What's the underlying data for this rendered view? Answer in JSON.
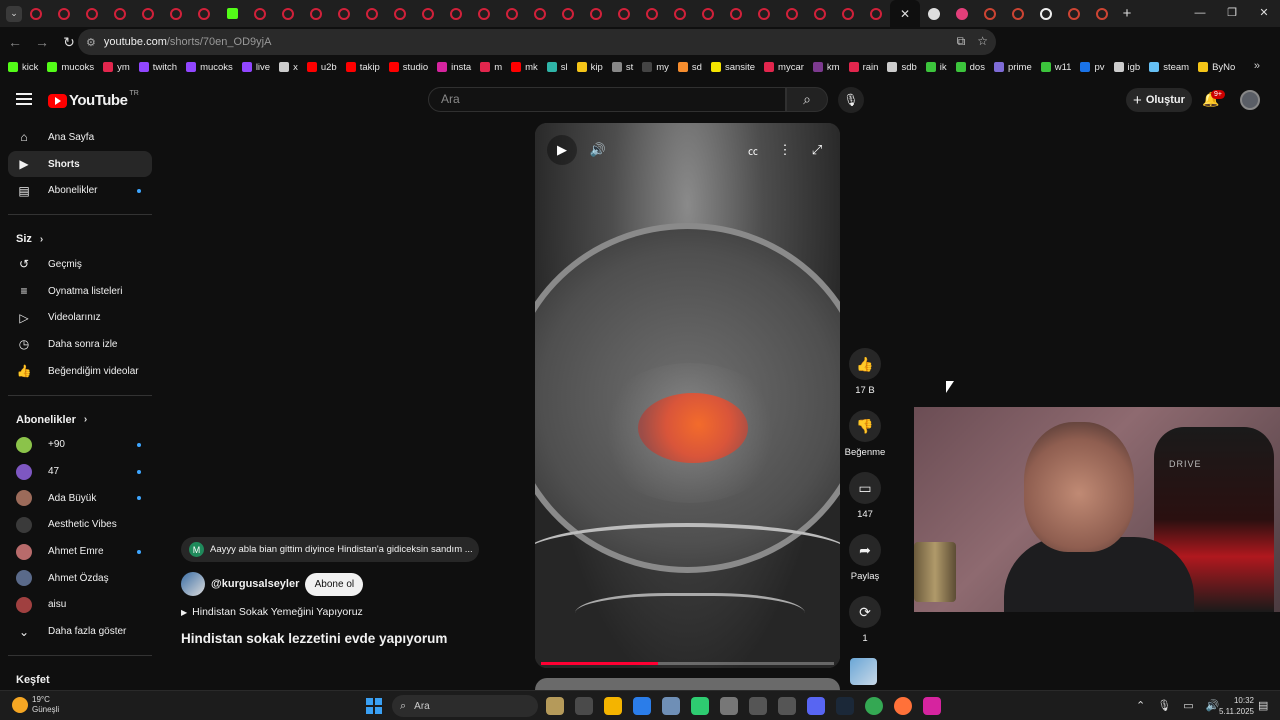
{
  "browser": {
    "active_tab_close": "✕",
    "url_host": "youtube.com",
    "url_path": "/shorts/70en_OD9yjA",
    "new_tab": "+",
    "win_minimize": "—",
    "win_restore": "❐",
    "win_close": "✕"
  },
  "bookmarks": [
    {
      "label": "kick",
      "color": "#53fc18"
    },
    {
      "label": "mucoks",
      "color": "#53fc18"
    },
    {
      "label": "ym",
      "color": "#e2264d"
    },
    {
      "label": "twitch",
      "color": "#9146ff"
    },
    {
      "label": "mucoks",
      "color": "#9146ff"
    },
    {
      "label": "live",
      "color": "#9146ff"
    },
    {
      "label": "x",
      "color": "#cccccc"
    },
    {
      "label": "u2b",
      "color": "#ff0000"
    },
    {
      "label": "takip",
      "color": "#ff0000"
    },
    {
      "label": "studio",
      "color": "#ff0000"
    },
    {
      "label": "insta",
      "color": "#d6249f"
    },
    {
      "label": "m",
      "color": "#e2264d"
    },
    {
      "label": "mk",
      "color": "#ff0000"
    },
    {
      "label": "sl",
      "color": "#2fb5a8"
    },
    {
      "label": "kip",
      "color": "#f5c518"
    },
    {
      "label": "st",
      "color": "#888888"
    },
    {
      "label": "my",
      "color": "#444444"
    },
    {
      "label": "sd",
      "color": "#f68d2e"
    },
    {
      "label": "sansite",
      "color": "#f5e400"
    },
    {
      "label": "mycar",
      "color": "#e2264d"
    },
    {
      "label": "km",
      "color": "#7c3a8f"
    },
    {
      "label": "rain",
      "color": "#e2264d"
    },
    {
      "label": "sdb",
      "color": "#cccccc"
    },
    {
      "label": "ik",
      "color": "#3cc43c"
    },
    {
      "label": "dos",
      "color": "#3cc43c"
    },
    {
      "label": "prime",
      "color": "#7e6bd6"
    },
    {
      "label": "w11",
      "color": "#3cc43c"
    },
    {
      "label": "pv",
      "color": "#1a73e8"
    },
    {
      "label": "igb",
      "color": "#cccccc"
    },
    {
      "label": "steam",
      "color": "#66c0f4"
    },
    {
      "label": "ByNo",
      "color": "#f5c518"
    }
  ],
  "bookmarks_more": "»",
  "yt": {
    "logo_text": "YouTube",
    "logo_region": "TR",
    "search_placeholder": "Ara",
    "create_label": "Oluştur",
    "notifications_badge": "9+"
  },
  "sidebar": {
    "main": [
      {
        "label": "Ana Sayfa",
        "icon": "home-icon",
        "glyph": "⌂"
      },
      {
        "label": "Shorts",
        "icon": "shorts-icon",
        "glyph": "▶",
        "active": true
      },
      {
        "label": "Abonelikler",
        "icon": "subscriptions-icon",
        "glyph": "▤",
        "dot": true
      }
    ],
    "you_header": "Siz",
    "you": [
      {
        "label": "Geçmiş",
        "icon": "history-icon",
        "glyph": "↺"
      },
      {
        "label": "Oynatma listeleri",
        "icon": "playlists-icon",
        "glyph": "≡"
      },
      {
        "label": "Videolarınız",
        "icon": "your-videos-icon",
        "glyph": "▷"
      },
      {
        "label": "Daha sonra izle",
        "icon": "watch-later-icon",
        "glyph": "◷"
      },
      {
        "label": "Beğendiğim videolar",
        "icon": "liked-videos-icon",
        "glyph": "👍"
      }
    ],
    "subs_header": "Abonelikler",
    "subs": [
      {
        "label": "+90",
        "color": "#8bc34a",
        "dot": true
      },
      {
        "label": "47",
        "color": "#7e57c2",
        "dot": true
      },
      {
        "label": "Ada Büyük",
        "color": "#9c6b5a",
        "dot": true
      },
      {
        "label": "Aesthetic Vibes",
        "color": "#3a3a3a",
        "dot": false
      },
      {
        "label": "Ahmet Emre",
        "color": "#b86b6b",
        "dot": true
      },
      {
        "label": "Ahmet Özdaş",
        "color": "#5a6a8a",
        "dot": false
      },
      {
        "label": "aisu",
        "color": "#a04040",
        "dot": false
      }
    ],
    "show_more": "Daha fazla göster",
    "explore_header": "Keşfet"
  },
  "short": {
    "progress": 0.4,
    "likes": "17 B",
    "dislike_label": "Beğenme",
    "comments": "147",
    "share_label": "Paylaş",
    "remix_count": "1",
    "pinned_comment_initial": "M",
    "pinned_comment": "Aayyy abla bian gittim diyince Hindistan'a gidiceksin sandım ...",
    "channel": "@kurgusalseyler",
    "subscribe_label": "Abone ol",
    "music": "Hindistan Sokak Yemeğini Yapıyoruz",
    "title": "Hindistan sokak lezzetini evde yapıyorum"
  },
  "webcam": {
    "chair_brand": "DRIVE"
  },
  "taskbar": {
    "temperature": "19°C",
    "weather": "Güneşli",
    "search_label": "Ara",
    "time": "10:32",
    "date": "5.11.2025"
  }
}
